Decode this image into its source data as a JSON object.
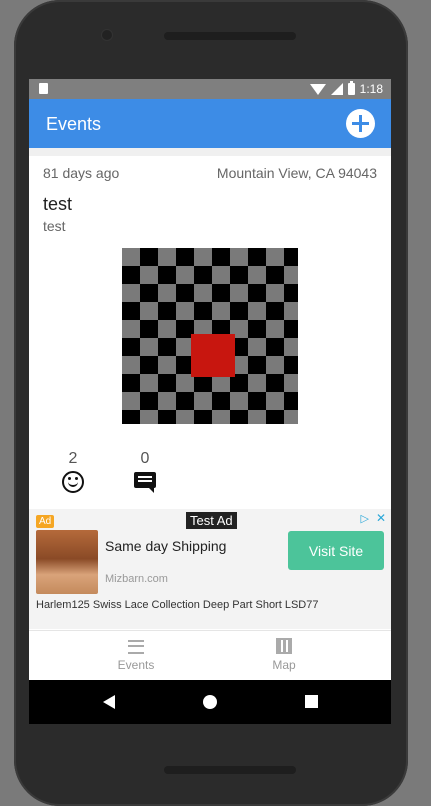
{
  "status_bar": {
    "time": "1:18"
  },
  "app_bar": {
    "title": "Events"
  },
  "event": {
    "time_ago": "81 days ago",
    "location": "Mountain View,  CA 94043",
    "title": "test",
    "description": "test",
    "smiley_count": "2",
    "comment_count": "0"
  },
  "ad": {
    "badge": "Ad",
    "test_label": "Test Ad",
    "adchoices_icon": "adchoices-icon",
    "headline": "Same day Shipping",
    "domain": "Mizbarn.com",
    "cta": "Visit Site",
    "body": "Harlem125 Swiss Lace Collection Deep Part Short LSD77",
    "cta_color": "#4cc49a"
  },
  "bottom_nav": {
    "items": [
      {
        "label": "Events",
        "icon": "list-icon"
      },
      {
        "label": "Map",
        "icon": "map-icon"
      }
    ]
  },
  "colors": {
    "accent": "#3d8ce6",
    "highlight": "#c8160f"
  }
}
